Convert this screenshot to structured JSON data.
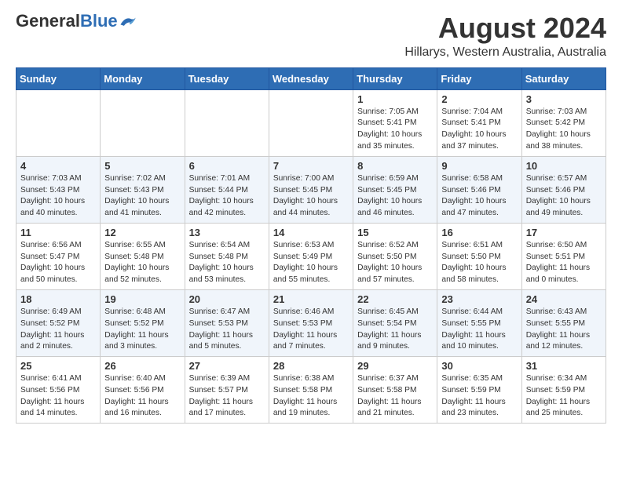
{
  "header": {
    "logo_general": "General",
    "logo_blue": "Blue",
    "month_year": "August 2024",
    "location": "Hillarys, Western Australia, Australia"
  },
  "weekdays": [
    "Sunday",
    "Monday",
    "Tuesday",
    "Wednesday",
    "Thursday",
    "Friday",
    "Saturday"
  ],
  "weeks": [
    [
      {
        "day": "",
        "info": ""
      },
      {
        "day": "",
        "info": ""
      },
      {
        "day": "",
        "info": ""
      },
      {
        "day": "",
        "info": ""
      },
      {
        "day": "1",
        "info": "Sunrise: 7:05 AM\nSunset: 5:41 PM\nDaylight: 10 hours\nand 35 minutes."
      },
      {
        "day": "2",
        "info": "Sunrise: 7:04 AM\nSunset: 5:41 PM\nDaylight: 10 hours\nand 37 minutes."
      },
      {
        "day": "3",
        "info": "Sunrise: 7:03 AM\nSunset: 5:42 PM\nDaylight: 10 hours\nand 38 minutes."
      }
    ],
    [
      {
        "day": "4",
        "info": "Sunrise: 7:03 AM\nSunset: 5:43 PM\nDaylight: 10 hours\nand 40 minutes."
      },
      {
        "day": "5",
        "info": "Sunrise: 7:02 AM\nSunset: 5:43 PM\nDaylight: 10 hours\nand 41 minutes."
      },
      {
        "day": "6",
        "info": "Sunrise: 7:01 AM\nSunset: 5:44 PM\nDaylight: 10 hours\nand 42 minutes."
      },
      {
        "day": "7",
        "info": "Sunrise: 7:00 AM\nSunset: 5:45 PM\nDaylight: 10 hours\nand 44 minutes."
      },
      {
        "day": "8",
        "info": "Sunrise: 6:59 AM\nSunset: 5:45 PM\nDaylight: 10 hours\nand 46 minutes."
      },
      {
        "day": "9",
        "info": "Sunrise: 6:58 AM\nSunset: 5:46 PM\nDaylight: 10 hours\nand 47 minutes."
      },
      {
        "day": "10",
        "info": "Sunrise: 6:57 AM\nSunset: 5:46 PM\nDaylight: 10 hours\nand 49 minutes."
      }
    ],
    [
      {
        "day": "11",
        "info": "Sunrise: 6:56 AM\nSunset: 5:47 PM\nDaylight: 10 hours\nand 50 minutes."
      },
      {
        "day": "12",
        "info": "Sunrise: 6:55 AM\nSunset: 5:48 PM\nDaylight: 10 hours\nand 52 minutes."
      },
      {
        "day": "13",
        "info": "Sunrise: 6:54 AM\nSunset: 5:48 PM\nDaylight: 10 hours\nand 53 minutes."
      },
      {
        "day": "14",
        "info": "Sunrise: 6:53 AM\nSunset: 5:49 PM\nDaylight: 10 hours\nand 55 minutes."
      },
      {
        "day": "15",
        "info": "Sunrise: 6:52 AM\nSunset: 5:50 PM\nDaylight: 10 hours\nand 57 minutes."
      },
      {
        "day": "16",
        "info": "Sunrise: 6:51 AM\nSunset: 5:50 PM\nDaylight: 10 hours\nand 58 minutes."
      },
      {
        "day": "17",
        "info": "Sunrise: 6:50 AM\nSunset: 5:51 PM\nDaylight: 11 hours\nand 0 minutes."
      }
    ],
    [
      {
        "day": "18",
        "info": "Sunrise: 6:49 AM\nSunset: 5:52 PM\nDaylight: 11 hours\nand 2 minutes."
      },
      {
        "day": "19",
        "info": "Sunrise: 6:48 AM\nSunset: 5:52 PM\nDaylight: 11 hours\nand 3 minutes."
      },
      {
        "day": "20",
        "info": "Sunrise: 6:47 AM\nSunset: 5:53 PM\nDaylight: 11 hours\nand 5 minutes."
      },
      {
        "day": "21",
        "info": "Sunrise: 6:46 AM\nSunset: 5:53 PM\nDaylight: 11 hours\nand 7 minutes."
      },
      {
        "day": "22",
        "info": "Sunrise: 6:45 AM\nSunset: 5:54 PM\nDaylight: 11 hours\nand 9 minutes."
      },
      {
        "day": "23",
        "info": "Sunrise: 6:44 AM\nSunset: 5:55 PM\nDaylight: 11 hours\nand 10 minutes."
      },
      {
        "day": "24",
        "info": "Sunrise: 6:43 AM\nSunset: 5:55 PM\nDaylight: 11 hours\nand 12 minutes."
      }
    ],
    [
      {
        "day": "25",
        "info": "Sunrise: 6:41 AM\nSunset: 5:56 PM\nDaylight: 11 hours\nand 14 minutes."
      },
      {
        "day": "26",
        "info": "Sunrise: 6:40 AM\nSunset: 5:56 PM\nDaylight: 11 hours\nand 16 minutes."
      },
      {
        "day": "27",
        "info": "Sunrise: 6:39 AM\nSunset: 5:57 PM\nDaylight: 11 hours\nand 17 minutes."
      },
      {
        "day": "28",
        "info": "Sunrise: 6:38 AM\nSunset: 5:58 PM\nDaylight: 11 hours\nand 19 minutes."
      },
      {
        "day": "29",
        "info": "Sunrise: 6:37 AM\nSunset: 5:58 PM\nDaylight: 11 hours\nand 21 minutes."
      },
      {
        "day": "30",
        "info": "Sunrise: 6:35 AM\nSunset: 5:59 PM\nDaylight: 11 hours\nand 23 minutes."
      },
      {
        "day": "31",
        "info": "Sunrise: 6:34 AM\nSunset: 5:59 PM\nDaylight: 11 hours\nand 25 minutes."
      }
    ]
  ]
}
